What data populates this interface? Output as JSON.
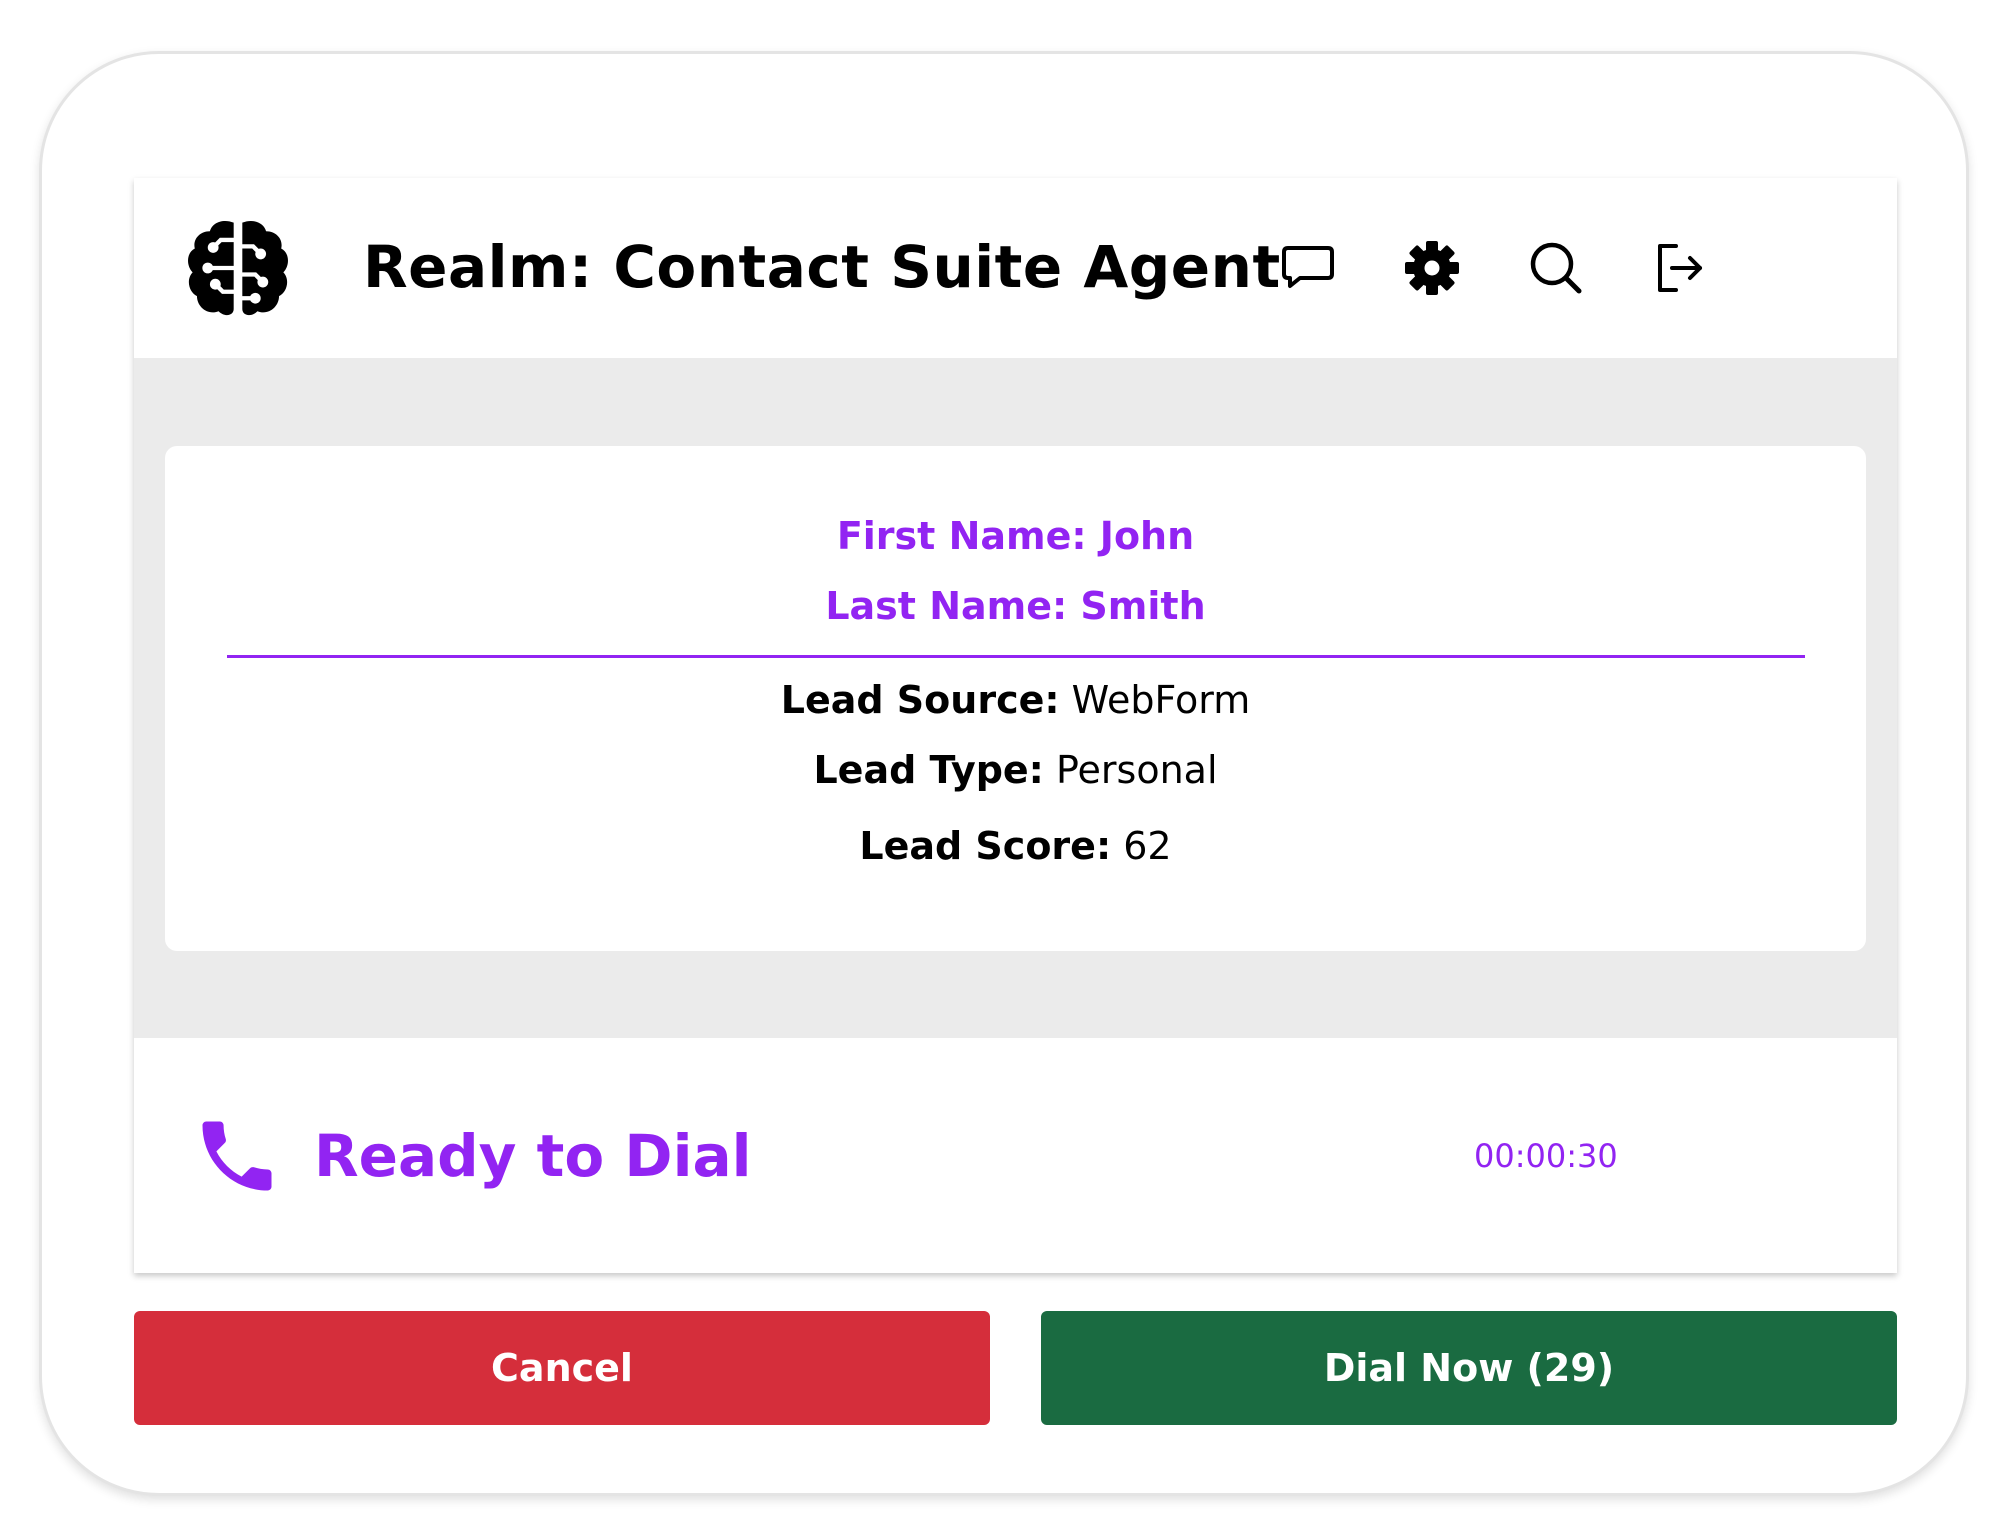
{
  "header": {
    "title": "Realm: Contact Suite Agent",
    "logo_icon": "brain-circuit-icon",
    "icons": [
      "chat-icon",
      "gear-icon",
      "search-icon",
      "logout-icon"
    ]
  },
  "contact": {
    "first_name": "First Name: John",
    "last_name": "Last Name: Smith",
    "lead_source_label": "Lead Source:",
    "lead_source_value": "WebForm",
    "lead_type_label": "Lead Type:",
    "lead_type_value": "Personal",
    "lead_score_label": "Lead Score:",
    "lead_score_value": "62"
  },
  "status": {
    "icon": "phone-icon",
    "text": "Ready to Dial",
    "timer": "00:00:30"
  },
  "actions": {
    "cancel_label": "Cancel",
    "dial_label": "Dial Now (29)"
  },
  "colors": {
    "accent": "#9224f2",
    "cancel": "#d52e3b",
    "dial": "#1a6b41",
    "panel_bg": "#ebebeb"
  }
}
